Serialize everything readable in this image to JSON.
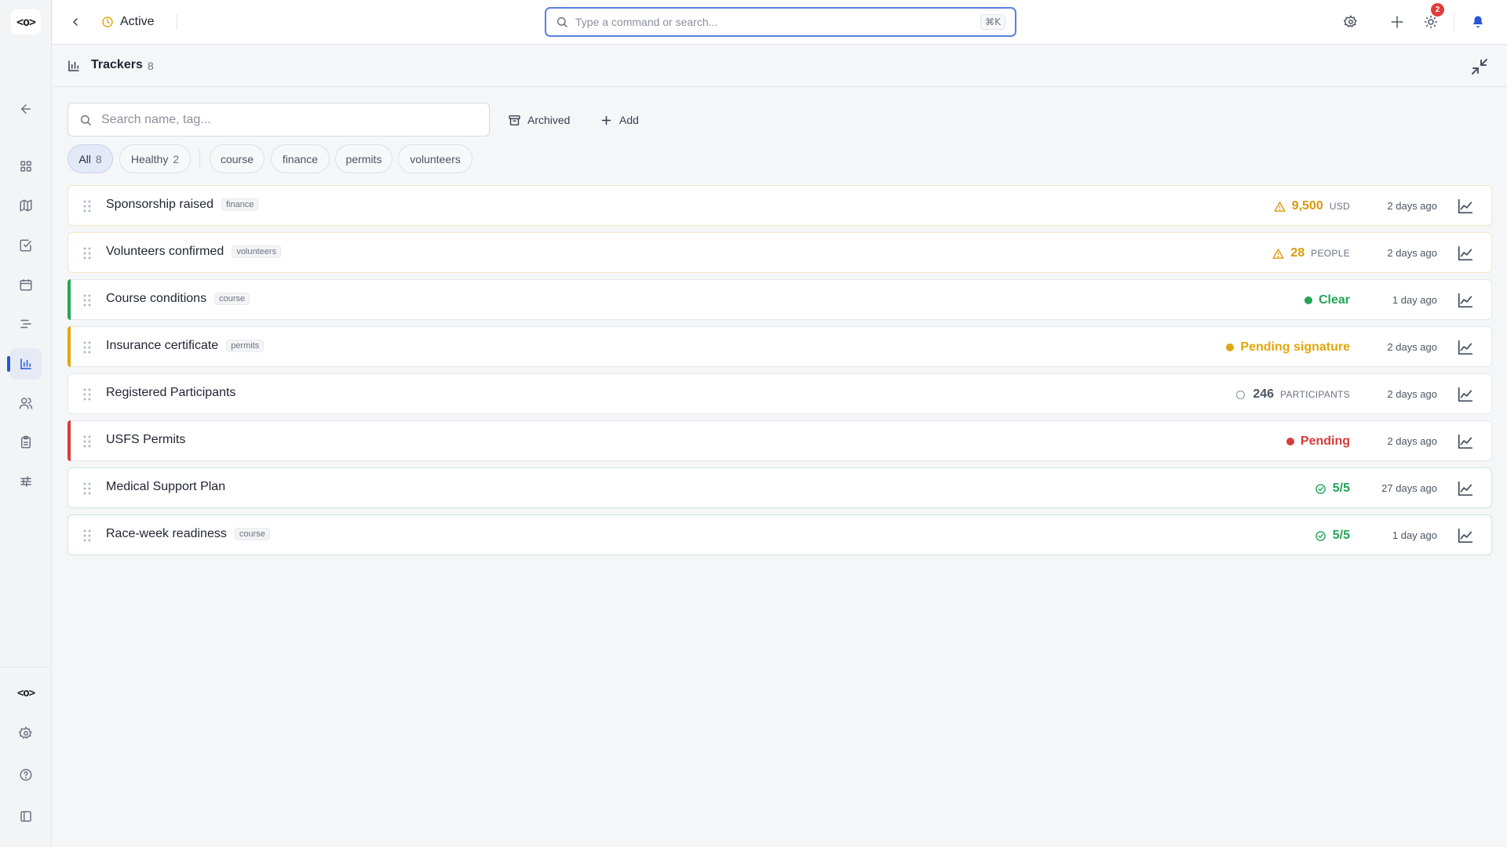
{
  "sidebar": {
    "logo": "<o>",
    "items": [
      {
        "icon": "arrow-left-icon"
      },
      {
        "icon": "dashboard-icon"
      },
      {
        "icon": "map-icon"
      },
      {
        "icon": "check-square-icon"
      },
      {
        "icon": "calendar-icon"
      },
      {
        "icon": "list-icon"
      },
      {
        "icon": "bar-chart-icon",
        "active": true
      },
      {
        "icon": "users-icon"
      },
      {
        "icon": "clipboard-icon"
      },
      {
        "icon": "sliders-icon"
      }
    ],
    "bottom_logo": "<o>",
    "bottom_items": [
      {
        "icon": "gear-icon"
      },
      {
        "icon": "help-icon"
      },
      {
        "icon": "panel-icon"
      }
    ]
  },
  "topbar": {
    "status": "Active",
    "command_placeholder": "Type a command or search...",
    "shortcut": "⌘K",
    "notification_count": "2"
  },
  "section": {
    "title": "Trackers",
    "count": "8"
  },
  "toolbar": {
    "search_placeholder": "Search name, tag...",
    "archived_label": "Archived",
    "add_label": "Add"
  },
  "filters": [
    {
      "label": "All",
      "count": "8",
      "selected": true
    },
    {
      "label": "Healthy",
      "count": "2"
    },
    {
      "label": "course"
    },
    {
      "label": "finance"
    },
    {
      "label": "permits"
    },
    {
      "label": "volunteers"
    }
  ],
  "trackers": [
    {
      "name": "Sponsorship raised",
      "tag": "finance",
      "status_icon": "warning-icon",
      "value": "9,500",
      "unit": "USD",
      "updated": "2 days ago",
      "color": "#d99a0a"
    },
    {
      "name": "Volunteers confirmed",
      "tag": "volunteers",
      "status_icon": "warning-icon",
      "value": "28",
      "unit": "PEOPLE",
      "updated": "2 days ago",
      "color": "#d99a0a"
    },
    {
      "name": "Course conditions",
      "tag": "course",
      "status_icon": "dot",
      "value": "Clear",
      "unit": "",
      "updated": "1 day ago",
      "color": "#22a559"
    },
    {
      "name": "Insurance certificate",
      "tag": "permits",
      "status_icon": "dot",
      "value": "Pending signature",
      "unit": "",
      "updated": "2 days ago",
      "color": "#e0a80c"
    },
    {
      "name": "Registered Participants",
      "tag": "",
      "status_icon": "circle-outline-icon",
      "value": "246",
      "unit": "PARTICIPANTS",
      "updated": "2 days ago",
      "color": "#4b5563"
    },
    {
      "name": "USFS Permits",
      "tag": "",
      "status_icon": "dot",
      "value": "Pending",
      "unit": "",
      "updated": "2 days ago",
      "color": "#d93b3b"
    },
    {
      "name": "Medical Support Plan",
      "tag": "",
      "status_icon": "check-circle-icon",
      "value": "5/5",
      "unit": "",
      "updated": "27 days ago",
      "color": "#22a559"
    },
    {
      "name": "Race-week readiness",
      "tag": "course",
      "status_icon": "check-circle-icon",
      "value": "5/5",
      "unit": "",
      "updated": "1 day ago",
      "color": "#22a559"
    }
  ]
}
